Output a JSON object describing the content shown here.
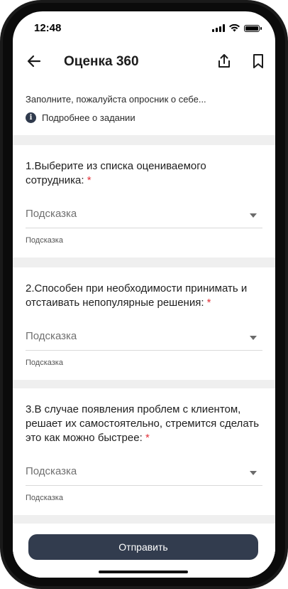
{
  "status_bar": {
    "time": "12:48"
  },
  "header": {
    "title": "Оценка 360"
  },
  "intro": {
    "text": "Заполните, пожалуйста опросник о себе...",
    "details_label": "Подробнее о задании"
  },
  "questions": [
    {
      "text": "1.Выберите из списка оцениваемого сотрудника:",
      "required_mark": "*",
      "select_placeholder": "Подсказка",
      "hint": "Подсказка"
    },
    {
      "text": "2.Способен при необходимости принимать и отстаивать непопулярные решения:",
      "required_mark": "*",
      "select_placeholder": "Подсказка",
      "hint": "Подсказка"
    },
    {
      "text": "3.В случае появления проблем с клиентом, решает их самостоятельно, стремится сделать это как можно быстрее:",
      "required_mark": "*",
      "select_placeholder": "Подсказка",
      "hint": "Подсказка"
    }
  ],
  "submit_label": "Отправить",
  "colors": {
    "accent": "#323c4e",
    "required": "#e2323a"
  }
}
